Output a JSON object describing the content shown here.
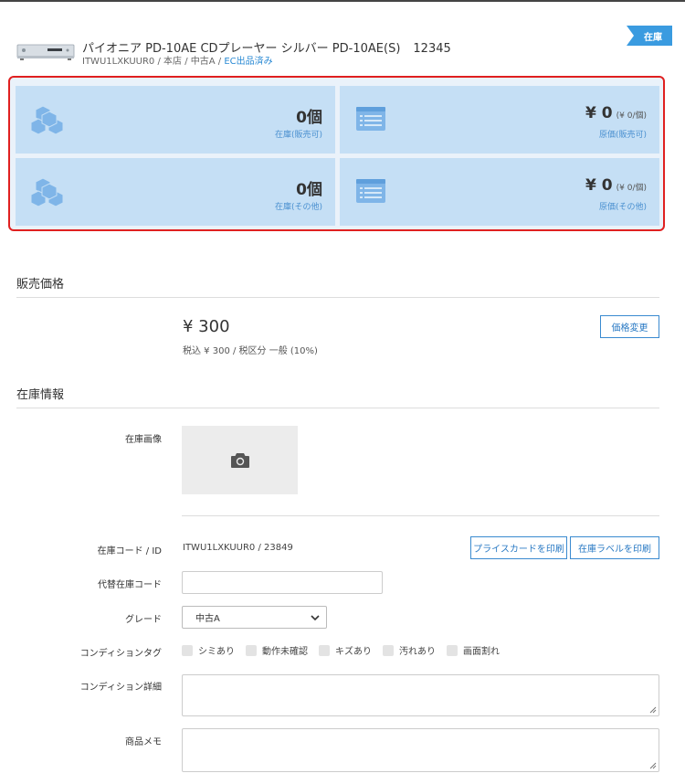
{
  "product": {
    "title": "パイオニア PD-10AE CDプレーヤー シルバー PD-10AE(S)",
    "number": "12345",
    "sub_text": "ITWU1LXKUUR0 / 本店 / 中古A / ",
    "ec_link": "EC出品済み",
    "status_ribbon": "在庫"
  },
  "summary": {
    "stock_sellable_value": "0個",
    "stock_sellable_label": "在庫(販売可)",
    "cost_sellable_value": "¥ 0",
    "cost_sellable_unit": "(¥ 0/個)",
    "cost_sellable_label": "原価(販売可)",
    "stock_other_value": "0個",
    "stock_other_label": "在庫(その他)",
    "cost_other_value": "¥ 0",
    "cost_other_unit": "(¥ 0/個)",
    "cost_other_label": "原価(その他)"
  },
  "sales_price": {
    "section_title": "販売価格",
    "price": "¥ 300",
    "tax_detail": "税込 ¥ 300 / 税区分 一般 (10%)",
    "change_button": "価格変更"
  },
  "stock_info": {
    "section_title": "在庫情報",
    "image_label": "在庫画像",
    "code_label": "在庫コード / ID",
    "code_value": "ITWU1LXKUUR0 / 23849",
    "print_price_card": "プライスカードを印刷",
    "print_stock_label": "在庫ラベルを印刷",
    "alt_code_label": "代替在庫コード",
    "alt_code_value": "",
    "grade_label": "グレード",
    "grade_value": "中古A",
    "condition_tag_label": "コンディションタグ",
    "condition_tags": [
      "シミあり",
      "動作未確認",
      "キズあり",
      "汚れあり",
      "画面割れ"
    ],
    "condition_detail_label": "コンディション詳細",
    "product_memo_label": "商品メモ"
  },
  "colors": {
    "accent": "#3a9be0",
    "summary_box": "#c5dff5",
    "highlight_border": "#e02020",
    "link": "#2a8ad4"
  }
}
